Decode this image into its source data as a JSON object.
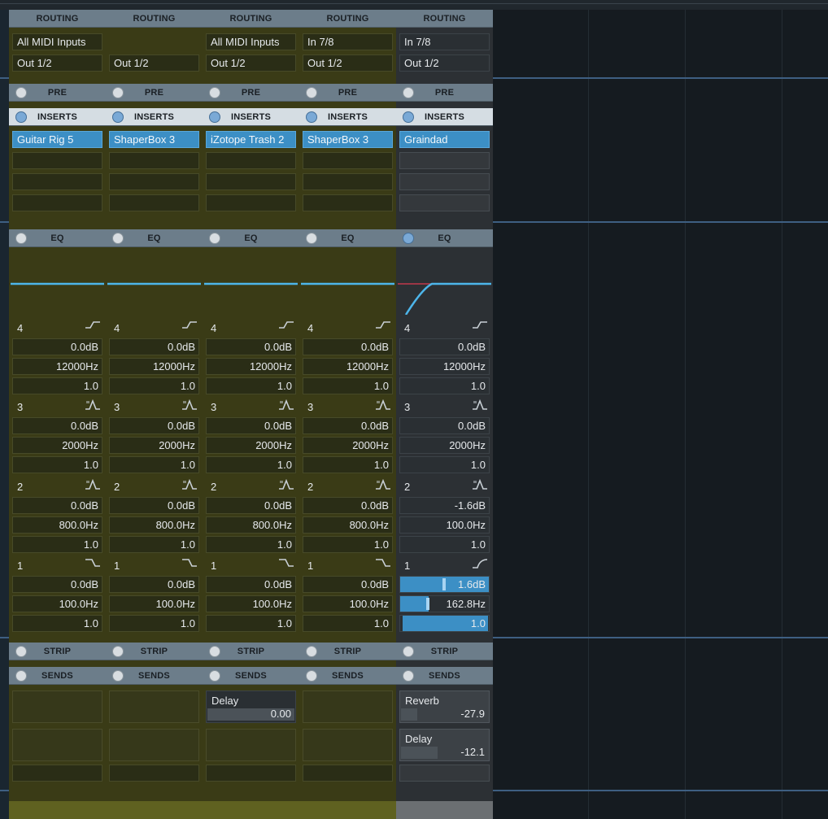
{
  "colors": {
    "yellow_channel": "#3a3b16",
    "gray_channel": "#2c3034",
    "insert_active": "#3c8fc5",
    "eq_curve": "#4db5ea",
    "eq_curve_alt": "#c0394b"
  },
  "headers": {
    "routing": "ROUTING",
    "pre": "PRE",
    "inserts": "INSERTS",
    "eq": "EQ",
    "strip": "STRIP",
    "sends": "SENDS"
  },
  "channels": [
    {
      "input": "All MIDI Inputs",
      "output": "Out 1/2",
      "insert1": "Guitar Rig 5",
      "bands": [
        {
          "num": "4",
          "icon": "highshelf-icon",
          "gain": "0.0dB",
          "freq": "12000Hz",
          "q": "1.0"
        },
        {
          "num": "3",
          "icon": "peak-icon",
          "gain": "0.0dB",
          "freq": "2000Hz",
          "q": "1.0"
        },
        {
          "num": "2",
          "icon": "peak-icon",
          "gain": "0.0dB",
          "freq": "800.0Hz",
          "q": "1.0"
        },
        {
          "num": "1",
          "icon": "lowshelf-icon",
          "gain": "0.0dB",
          "freq": "100.0Hz",
          "q": "1.0"
        }
      ],
      "sends": []
    },
    {
      "input": "",
      "output": "Out 1/2",
      "insert1": "ShaperBox 3",
      "bands": [
        {
          "num": "4",
          "icon": "highshelf-icon",
          "gain": "0.0dB",
          "freq": "12000Hz",
          "q": "1.0"
        },
        {
          "num": "3",
          "icon": "peak-icon",
          "gain": "0.0dB",
          "freq": "2000Hz",
          "q": "1.0"
        },
        {
          "num": "2",
          "icon": "peak-icon",
          "gain": "0.0dB",
          "freq": "800.0Hz",
          "q": "1.0"
        },
        {
          "num": "1",
          "icon": "lowshelf-icon",
          "gain": "0.0dB",
          "freq": "100.0Hz",
          "q": "1.0"
        }
      ],
      "sends": []
    },
    {
      "input": "All MIDI Inputs",
      "output": "Out 1/2",
      "insert1": "iZotope Trash 2",
      "bands": [
        {
          "num": "4",
          "icon": "highshelf-icon",
          "gain": "0.0dB",
          "freq": "12000Hz",
          "q": "1.0"
        },
        {
          "num": "3",
          "icon": "peak-icon",
          "gain": "0.0dB",
          "freq": "2000Hz",
          "q": "1.0"
        },
        {
          "num": "2",
          "icon": "peak-icon",
          "gain": "0.0dB",
          "freq": "800.0Hz",
          "q": "1.0"
        },
        {
          "num": "1",
          "icon": "lowshelf-icon",
          "gain": "0.0dB",
          "freq": "100.0Hz",
          "q": "1.0"
        }
      ],
      "sends": [
        {
          "name": "Delay",
          "value": "0.00"
        }
      ]
    },
    {
      "input": "In 7/8",
      "output": "Out 1/2",
      "insert1": "ShaperBox 3",
      "bands": [
        {
          "num": "4",
          "icon": "highshelf-icon",
          "gain": "0.0dB",
          "freq": "12000Hz",
          "q": "1.0"
        },
        {
          "num": "3",
          "icon": "peak-icon",
          "gain": "0.0dB",
          "freq": "2000Hz",
          "q": "1.0"
        },
        {
          "num": "2",
          "icon": "peak-icon",
          "gain": "0.0dB",
          "freq": "800.0Hz",
          "q": "1.0"
        },
        {
          "num": "1",
          "icon": "lowshelf-icon",
          "gain": "0.0dB",
          "freq": "100.0Hz",
          "q": "1.0"
        }
      ],
      "sends": []
    },
    {
      "input": "In 7/8",
      "output": "Out 1/2",
      "insert1": "Graindad",
      "bands": [
        {
          "num": "4",
          "icon": "highshelf-icon",
          "gain": "0.0dB",
          "freq": "12000Hz",
          "q": "1.0"
        },
        {
          "num": "3",
          "icon": "peak-icon",
          "gain": "0.0dB",
          "freq": "2000Hz",
          "q": "1.0"
        },
        {
          "num": "2",
          "icon": "peak-icon",
          "gain": "-1.6dB",
          "freq": "100.0Hz",
          "q": "1.0"
        },
        {
          "num": "1",
          "icon": "highpass-icon",
          "gain": "1.6dB",
          "freq": "162.8Hz",
          "q": "1.0"
        }
      ],
      "sends": [
        {
          "name": "Reverb",
          "value": "-27.9"
        },
        {
          "name": "Delay",
          "value": "-12.1"
        }
      ]
    }
  ]
}
